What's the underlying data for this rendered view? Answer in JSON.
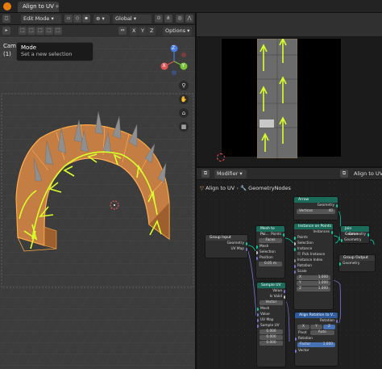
{
  "topbar": {
    "tab": "Align to UV",
    "add": "+"
  },
  "viewport": {
    "mode": "Edit Mode",
    "transform": "Global",
    "options": "Options",
    "axes": {
      "x": "X",
      "y": "Y",
      "z": "Z"
    },
    "info_line1": "Cam",
    "info_line2": "(1)",
    "tooltip": {
      "title": "Mode",
      "desc": "Set a new selection"
    },
    "gizmo": {
      "x": "X",
      "y": "Y",
      "z": "Z"
    }
  },
  "node_editor": {
    "header": {
      "modifier": "Modifier",
      "object": "Align to UV"
    },
    "breadcrumb": {
      "object": "Align to UV",
      "modifier": "GeometryNodes"
    },
    "arrow": {
      "title": "Arrow",
      "geometry": "Geometry",
      "vertices": "Vertices",
      "vertices_val": "40"
    },
    "group_input": {
      "title": "Group Input",
      "geometry": "Geometry",
      "uvmap": "UV Map"
    },
    "mesh_to_points": {
      "title": "Mesh to Poi...",
      "points": "Points",
      "mode": "Faces",
      "mesh": "Mesh",
      "selection": "Selection",
      "position": "Position",
      "radius": "0.05 m"
    },
    "instance_on_points": {
      "title": "Instance on Points",
      "instances": "Instances",
      "points": "Points",
      "selection": "Selection",
      "instance": "Instance",
      "pick": "Pick Instance",
      "index": "Instance Index",
      "rotation": "Rotation",
      "scale": "Scale",
      "x": "1.000",
      "y": "1.000",
      "z": "1.000",
      "xl": "X",
      "yl": "Y",
      "zl": "Z"
    },
    "join": {
      "title": "Join Geome...",
      "geometry": "Geometry"
    },
    "group_output": {
      "title": "Group Output",
      "geometry": "Geometry"
    },
    "sample_uv": {
      "title": "Sample UV",
      "value": "Value",
      "isvalid": "Is Valid",
      "type": "Vector",
      "mesh": "Mesh",
      "value_in": "Value",
      "uvmap": "UV Map",
      "sample": "Sample UV",
      "f1": "0.000",
      "f2": "0.000",
      "f3": "0.000"
    },
    "align": {
      "title": "Align Rotation to V...",
      "rotation_out": "Rotation",
      "x": "X",
      "y": "Y",
      "z": "Z",
      "pivot_label": "Pivot",
      "pivot": "Auto",
      "rotation": "Rotation",
      "factor": "Factor",
      "factor_val": "1.000",
      "vector": "Vector"
    }
  },
  "colors": {
    "selected_mesh": "#e8a060",
    "arrows": "#d8ff2a",
    "header_blue": "#4772b3",
    "node_green": "#1b6b5a",
    "node_blue": "#2d5a9a"
  }
}
